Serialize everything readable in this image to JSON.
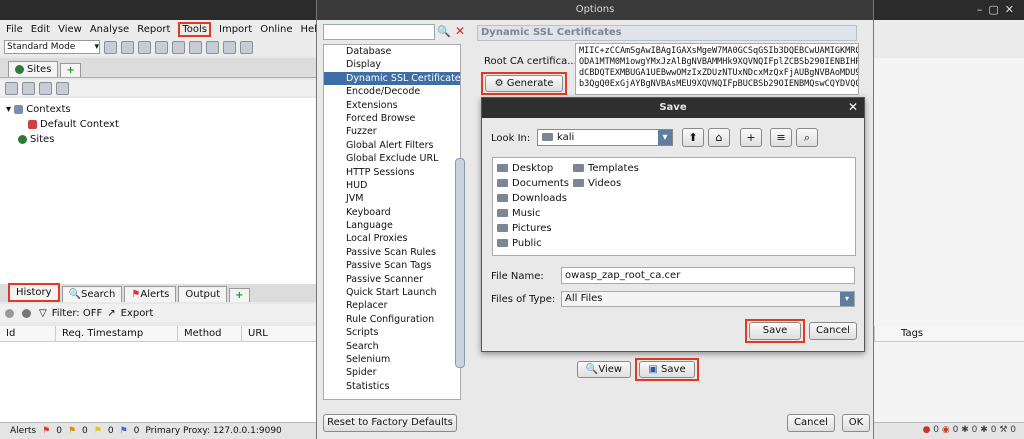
{
  "window": {
    "options_title": "Options",
    "save_title": "Save"
  },
  "menu": [
    "File",
    "Edit",
    "View",
    "Analyse",
    "Report",
    "Tools",
    "Import",
    "Online",
    "Help"
  ],
  "toolbar": {
    "mode": "Standard Mode"
  },
  "sites_tab": "Sites",
  "tree": {
    "contexts": "Contexts",
    "default_context": "Default Context",
    "sites": "Sites"
  },
  "bottom_tabs": {
    "history": "History",
    "search": "Search",
    "alerts": "Alerts",
    "output": "Output"
  },
  "history": {
    "filter": "Filter: OFF",
    "export": "Export",
    "columns": [
      "Id",
      "Req. Timestamp",
      "Method",
      "URL"
    ],
    "tags": "Tags"
  },
  "status": {
    "alerts": "Alerts",
    "flags": [
      "0",
      "0",
      "0",
      "0"
    ],
    "proxy": "Primary Proxy: 127.0.0.1:9090",
    "right_counts": [
      "0",
      "0",
      "0",
      "0",
      "0"
    ]
  },
  "options": {
    "list": [
      "Database",
      "Display",
      "Dynamic SSL Certificates",
      "Encode/Decode",
      "Extensions",
      "Forced Browse",
      "Fuzzer",
      "Global Alert Filters",
      "Global Exclude URL",
      "HTTP Sessions",
      "HUD",
      "JVM",
      "Keyboard",
      "Language",
      "Local Proxies",
      "Passive Scan Rules",
      "Passive Scan Tags",
      "Passive Scanner",
      "Quick Start Launch",
      "Replacer",
      "Rule Configuration",
      "Scripts",
      "Search",
      "Selenium",
      "Spider",
      "Statistics"
    ],
    "selected": "Dynamic SSL Certificates",
    "panel_title": "Dynamic SSL Certificates",
    "rootca_label": "Root CA certifica...",
    "cert_lines": [
      "MIIC+zCCAmSgAwIBAgIGAXsMgeW7MA0GCSqGSIb3DQEBCwUAMIGKMRQwEgYDVQQDDAtP",
      "ODA1MTM0M1owgYMxJzAlBgNVBAMMHk9XQVNQIFplZCBSb290IENBIHRhY2sg",
      "dCBDQTEXMBUGA1UEBwwOMzIxZDUzNTUxNDcxMzQxFjAUBgNVBAoMDU9XQVNQ",
      "b3QgQ0ExGjAYBgNVBAsMEU9XQVNQIFpBUCBSb29OIENBMQswCQYDVQQGEwJY"
    ],
    "generate": "Generate",
    "view": "View",
    "save": "Save",
    "reset": "Reset to Factory Defaults",
    "cancel": "Cancel",
    "ok": "OK"
  },
  "save_dialog": {
    "look_in_label": "Look In:",
    "look_in_value": "kali",
    "folders_col1": [
      "Desktop",
      "Documents",
      "Downloads",
      "Music",
      "Pictures",
      "Public"
    ],
    "folders_col2": [
      "Templates",
      "Videos"
    ],
    "file_name_label": "File Name:",
    "file_name_value": "owasp_zap_root_ca.cer",
    "files_of_type_label": "Files of Type:",
    "files_of_type_value": "All Files",
    "save": "Save",
    "cancel": "Cancel"
  }
}
